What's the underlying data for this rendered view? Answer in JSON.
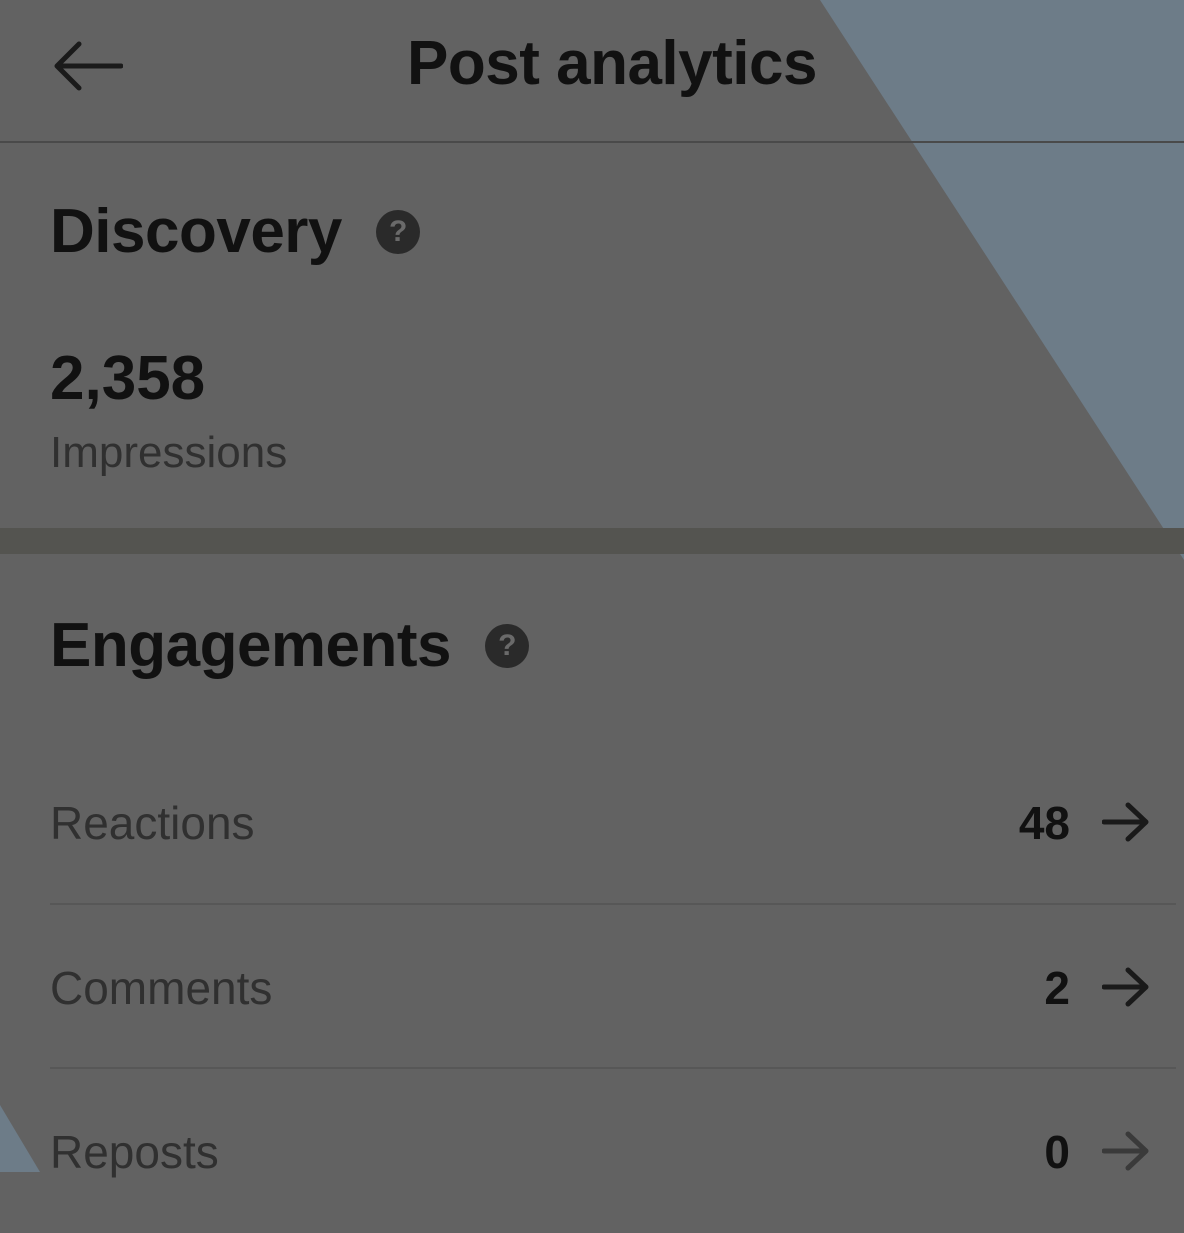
{
  "header": {
    "back_icon": "arrow-left-icon",
    "title": "Post analytics"
  },
  "discovery": {
    "title": "Discovery",
    "help_icon": "question-circle-icon",
    "impressions_value": "2,358",
    "impressions_label": "Impressions"
  },
  "engagements": {
    "title": "Engagements",
    "help_icon": "question-circle-icon",
    "rows": [
      {
        "label": "Reactions",
        "value": "48",
        "icon": "arrow-right-icon"
      },
      {
        "label": "Comments",
        "value": "2",
        "icon": "arrow-right-icon"
      },
      {
        "label": "Reposts",
        "value": "0",
        "icon": "arrow-right-icon"
      }
    ]
  },
  "colors": {
    "overlay_background": "#626262",
    "background_accent": "#6e7f8c",
    "text_primary": "#111111",
    "text_secondary": "#303030"
  }
}
